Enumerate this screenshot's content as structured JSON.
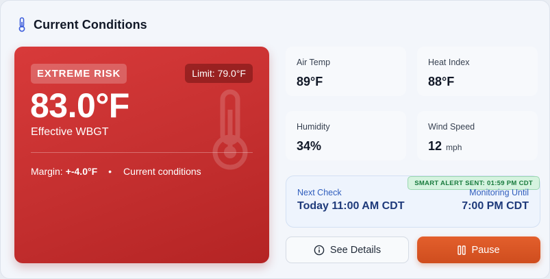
{
  "header": {
    "title": "Current Conditions",
    "icon": "thermometer-icon"
  },
  "risk": {
    "badge": "EXTREME RISK",
    "limit": "Limit: 79.0°F",
    "value": "83.0°F",
    "label": "Effective WBGT",
    "margin_prefix": "Margin:",
    "margin_value": "+-4.0°F",
    "separator": "•",
    "context": "Current conditions",
    "color": "#c62f2f"
  },
  "stats": [
    {
      "label": "Air Temp",
      "value": "89°F",
      "unit": ""
    },
    {
      "label": "Heat Index",
      "value": "88°F",
      "unit": ""
    },
    {
      "label": "Humidity",
      "value": "34%",
      "unit": ""
    },
    {
      "label": "Wind Speed",
      "value": "12",
      "unit": "mph"
    }
  ],
  "schedule": {
    "alert": "SMART ALERT SENT: 01:59 PM CDT",
    "next_check_label": "Next Check",
    "next_check_value": "Today 11:00 AM CDT",
    "monitoring_label": "Monitoring Until",
    "monitoring_value": "7:00 PM CDT"
  },
  "buttons": {
    "details_label": "See Details",
    "details_icon": "info-icon",
    "pause_label": "Pause",
    "pause_icon": "pause-icon",
    "pause_color": "#d9552a"
  }
}
